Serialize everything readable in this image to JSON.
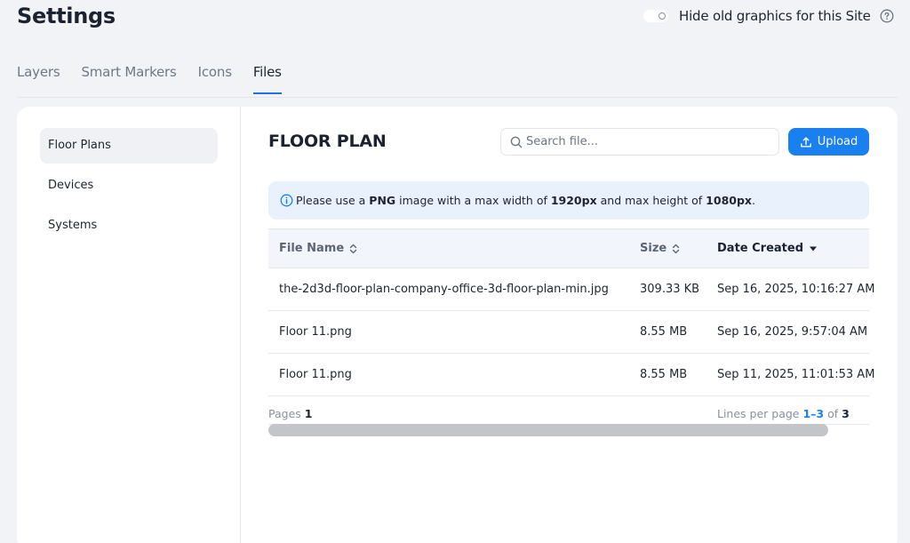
{
  "header": {
    "title": "Settings",
    "toggle_label": "Hide old graphics for this Site"
  },
  "tabs": [
    {
      "label": "Layers"
    },
    {
      "label": "Smart Markers"
    },
    {
      "label": "Icons"
    },
    {
      "label": "Files",
      "active": true
    }
  ],
  "sidebar": {
    "items": [
      {
        "label": "Floor Plans",
        "active": true
      },
      {
        "label": "Devices"
      },
      {
        "label": "Systems"
      }
    ]
  },
  "main": {
    "title": "FLOOR PLAN",
    "search_placeholder": "Search file...",
    "upload_label": "Upload",
    "info": {
      "t1": "Please use a ",
      "b1": "PNG",
      "t2": " image with a max width of ",
      "b2": "1920px",
      "t3": " and max height of ",
      "b3": "1080px",
      "t4": "."
    }
  },
  "table": {
    "headers": {
      "name": "File Name",
      "size": "Size",
      "date": "Date Created"
    },
    "rows": [
      {
        "name": "the-2d3d-floor-plan-company-office-3d-floor-plan-min.jpg",
        "size": "309.33 KB",
        "date": "Sep 16, 2025, 10:16:27 AM"
      },
      {
        "name": "Floor 11.png",
        "size": "8.55 MB",
        "date": "Sep 16, 2025, 9:57:04 AM"
      },
      {
        "name": "Floor 11.png",
        "size": "8.55 MB",
        "date": "Sep 11, 2025, 11:01:53 AM"
      }
    ],
    "footer": {
      "pages_label": "Pages ",
      "pages_value": "1",
      "lines_label": "Lines per page ",
      "range": "1–3",
      "of": " of ",
      "total": "3"
    }
  },
  "colors": {
    "accent": "#1a80f0",
    "info_bg": "#e8f1fc",
    "page_bg": "#f2f3f6"
  }
}
